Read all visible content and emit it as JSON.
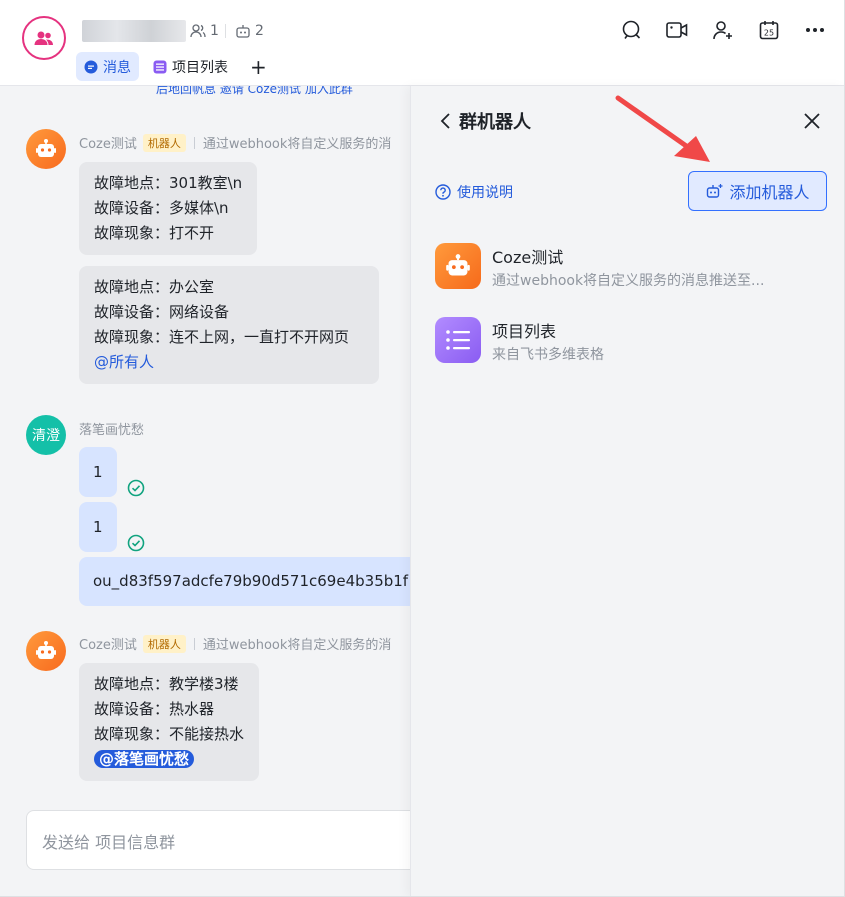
{
  "header": {
    "member_count": "1",
    "bot_count": "2",
    "tabs": [
      {
        "label": "消息",
        "active": true
      },
      {
        "label": "项目列表",
        "active": false
      }
    ],
    "add_tab": "+"
  },
  "chat": {
    "clipped_top_text": "后地回帆息 邀请 Coze测试 加入此群",
    "messages": [
      {
        "sender": "Coze测试",
        "tag": "机器人",
        "description": "通过webhook将自定义服务的消",
        "bubbles": [
          {
            "lines": [
              "故障地点：301教室\\n",
              "故障设备：多媒体\\n",
              "故障现象：打不开"
            ]
          },
          {
            "lines": [
              "故障地点：办公室",
              "故障设备：网络设备",
              "故障现象：连不上网，一直打不开网页"
            ],
            "mention": "@所有人"
          }
        ]
      },
      {
        "sender": "落笔画忧愁",
        "avatar_text": "清澄",
        "bubbles": [
          {
            "text": "1"
          },
          {
            "text": "1"
          },
          {
            "text": "ou_d83f597adcfe79b90d571c69e4b35b1f"
          }
        ]
      },
      {
        "sender": "Coze测试",
        "tag": "机器人",
        "description": "通过webhook将自定义服务的消",
        "bubbles": [
          {
            "lines": [
              "故障地点：教学楼3楼",
              "故障设备：热水器",
              "故障现象：不能接热水"
            ],
            "mention": "@落笔画忧愁"
          }
        ]
      }
    ],
    "composer_placeholder": "发送给 项目信息群"
  },
  "panel": {
    "title": "群机器人",
    "usage_link": "使用说明",
    "add_button": "添加机器人",
    "bots": [
      {
        "name": "Coze测试",
        "description": "通过webhook将自定义服务的消息推送至..."
      },
      {
        "name": "项目列表",
        "description": "来自飞书多维表格"
      }
    ]
  },
  "colors": {
    "accent": "#245bdb",
    "bot_orange": "#f86a1e",
    "annotation_arrow": "#f04848"
  }
}
